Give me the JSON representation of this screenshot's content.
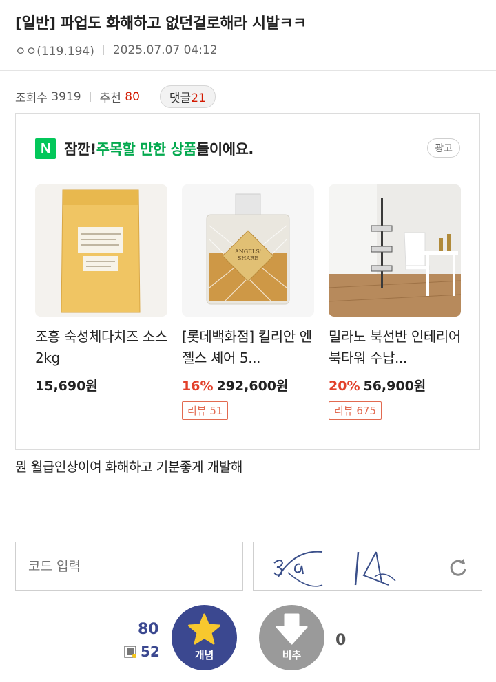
{
  "post": {
    "title": "[일반] 파업도 화해하고 없던걸로해라 시발ㅋㅋ",
    "author": "ㅇㅇ(119.194)",
    "date": "2025.07.07 04:12",
    "views_label": "조회수",
    "views": "3919",
    "recommend_label": "추천",
    "recommend": "80",
    "comments_label": "댓글",
    "comments": "21",
    "body": "뭔 월급인상이여 화해하고 기분좋게 개발해"
  },
  "ad": {
    "logo": "N",
    "headline_pre": "잠깐! ",
    "headline_hl": "주목할 만한 상품",
    "headline_post": "들이에요.",
    "badge": "광고",
    "products": [
      {
        "name": "조흥 숙성체다치즈 소스 2kg",
        "discount": "",
        "price": "15,690원",
        "review": ""
      },
      {
        "name": "[롯데백화점] 킬리안 엔젤스 셰어 5...",
        "discount": "16%",
        "price": "292,600원",
        "review": "리뷰 51"
      },
      {
        "name": "밀라노 북선반 인테리어 북타워 수납...",
        "discount": "20%",
        "price": "56,900원",
        "review": "리뷰 675"
      }
    ]
  },
  "captcha": {
    "placeholder": "코드 입력",
    "refresh_icon": "refresh-icon"
  },
  "vote": {
    "up_count": "80",
    "fixed_count": "52",
    "up_label": "개념",
    "down_label": "비추",
    "down_count": "0"
  },
  "colors": {
    "accent": "#3b4890",
    "naver_green": "#03c75a",
    "discount_red": "#e2412b"
  }
}
